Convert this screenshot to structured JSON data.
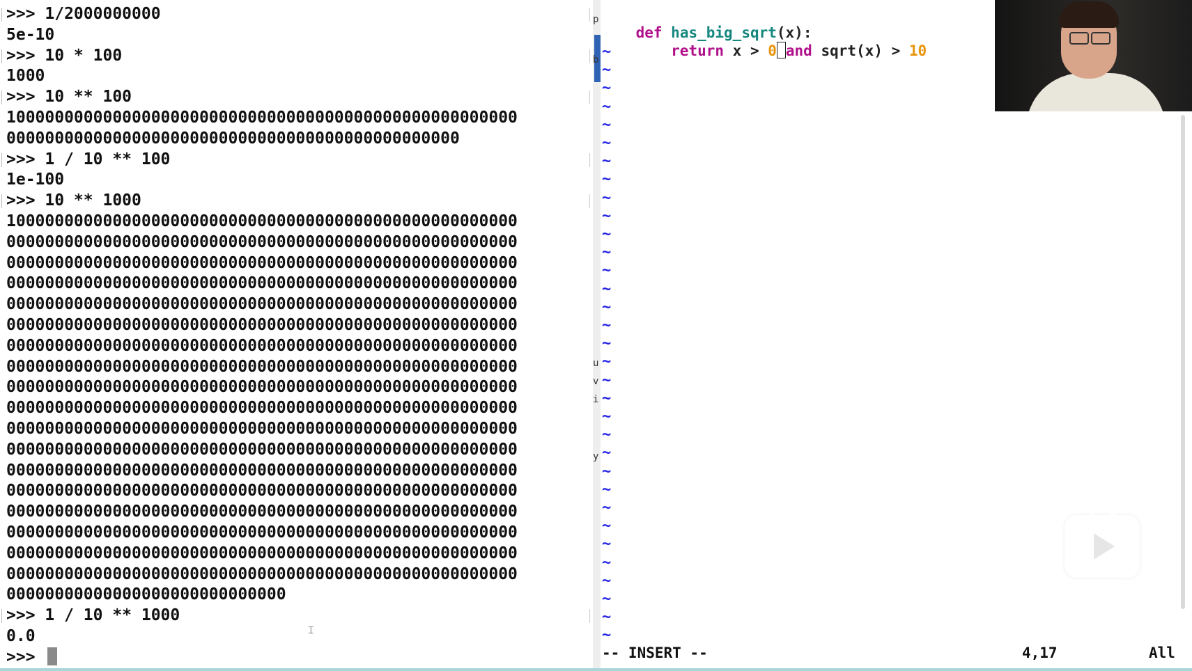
{
  "terminal": {
    "lines": [
      ">>> 1/2000000000",
      "5e-10",
      ">>> 10 * 100",
      "1000",
      ">>> 10 ** 100",
      "10000000000000000000000000000000000000000000000000000",
      "00000000000000000000000000000000000000000000000",
      ">>> 1 / 10 ** 100",
      "1e-100",
      ">>> 10 ** 1000",
      "10000000000000000000000000000000000000000000000000000",
      "00000000000000000000000000000000000000000000000000000",
      "00000000000000000000000000000000000000000000000000000",
      "00000000000000000000000000000000000000000000000000000",
      "00000000000000000000000000000000000000000000000000000",
      "00000000000000000000000000000000000000000000000000000",
      "00000000000000000000000000000000000000000000000000000",
      "00000000000000000000000000000000000000000000000000000",
      "00000000000000000000000000000000000000000000000000000",
      "00000000000000000000000000000000000000000000000000000",
      "00000000000000000000000000000000000000000000000000000",
      "00000000000000000000000000000000000000000000000000000",
      "00000000000000000000000000000000000000000000000000000",
      "00000000000000000000000000000000000000000000000000000",
      "00000000000000000000000000000000000000000000000000000",
      "00000000000000000000000000000000000000000000000000000",
      "00000000000000000000000000000000000000000000000000000",
      "00000000000000000000000000000000000000000000000000000",
      "00000000000000000000000000000",
      ">>> 1 / 10 ** 1000",
      "0.0"
    ],
    "prompt": ">>> "
  },
  "editor": {
    "line1": {
      "kw": "def",
      "fn": "has_big_sqrt",
      "rest": "(x):"
    },
    "line2": {
      "kw_return": "return",
      "pre": " x > ",
      "num_zero": "0",
      "kw_and": "and",
      "mid": " sqrt(x) > ",
      "num_ten": "10"
    },
    "tilde": "~",
    "tilde_count": 33,
    "status": {
      "mode": "-- INSERT --",
      "position": "4,17",
      "scroll": "All"
    }
  },
  "divider_glyphs": [
    "p",
    "b",
    "u",
    "v",
    "i",
    "y"
  ],
  "colors": {
    "keyword": "#b0108a",
    "function_name": "#14877f",
    "number": "#e8950b",
    "tilde": "#2323e6",
    "scroll_thumb": "#2f63b4"
  }
}
